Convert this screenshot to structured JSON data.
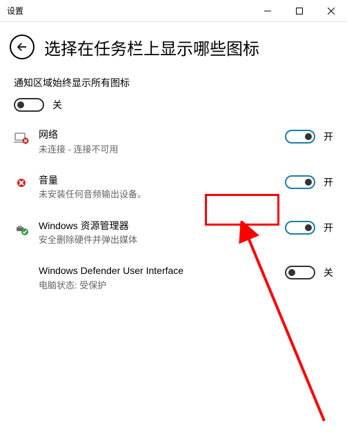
{
  "titlebar": {
    "title": "设置"
  },
  "header": {
    "page_title": "选择在任务栏上显示哪些图标"
  },
  "master": {
    "label": "通知区域始终显示所有图标",
    "state_label": "关"
  },
  "items": [
    {
      "icon": "network-error-icon",
      "title": "网络",
      "desc": "未连接 - 连接不可用",
      "state": "on",
      "state_label": "开"
    },
    {
      "icon": "volume-error-icon",
      "title": "音量",
      "desc": "未安装任何音频输出设备。",
      "state": "on",
      "state_label": "开"
    },
    {
      "icon": "explorer-icon",
      "title": "Windows 资源管理器",
      "desc": "安全删除硬件并弹出媒体",
      "state": "on",
      "state_label": "开"
    },
    {
      "icon": "defender-icon",
      "title": "Windows Defender User Interface",
      "desc": "电脑状态: 受保护",
      "state": "off",
      "state_label": "关"
    }
  ]
}
